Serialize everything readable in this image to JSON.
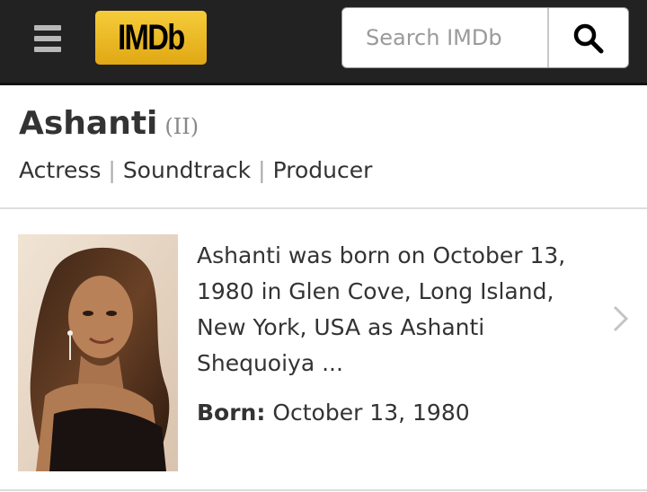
{
  "header": {
    "menu_icon": "hamburger-menu-icon",
    "logo_text": "IMDb",
    "search": {
      "placeholder": "Search IMDb",
      "value": ""
    }
  },
  "person": {
    "name": "Ashanti",
    "suffix": "(II)",
    "roles": [
      "Actress",
      "Soundtrack",
      "Producer"
    ]
  },
  "bio": {
    "summary": "Ashanti was born on October 13, 1980 in Glen Cove, Long Island, New York, USA as Ashanti Shequoiya ...",
    "born_label": "Born:",
    "born_value": "October 13, 1980"
  },
  "colors": {
    "topbar": "#222222",
    "logo": "#f5c518",
    "text": "#333333"
  }
}
